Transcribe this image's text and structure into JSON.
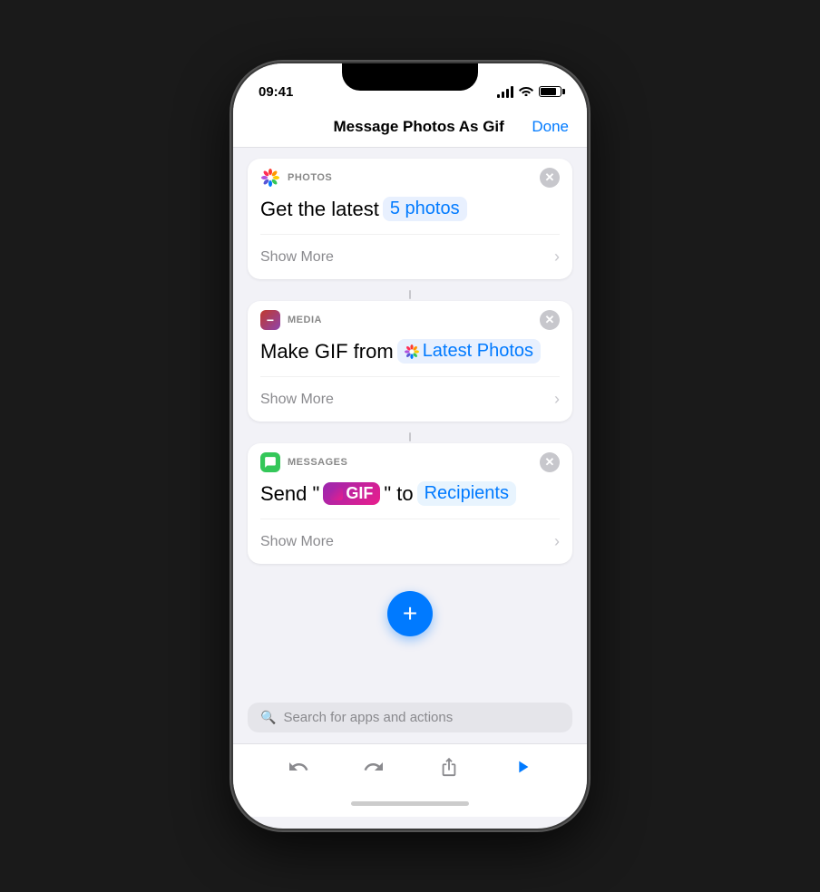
{
  "phone": {
    "time": "09:41",
    "title": "Message Photos As Gif",
    "done_button": "Done"
  },
  "cards": [
    {
      "id": "photos",
      "icon_label": "PHOTOS",
      "body_text": "Get the latest",
      "token_text": "5 photos",
      "show_more": "Show More"
    },
    {
      "id": "media",
      "icon_label": "MEDIA",
      "body_text": "Make GIF from",
      "token_text": "Latest Photos",
      "show_more": "Show More"
    },
    {
      "id": "messages",
      "icon_label": "MESSAGES",
      "body_prefix": "Send \"",
      "token_gif": "GIF",
      "body_suffix": "\" to",
      "token_recipients": "Recipients",
      "show_more": "Show More"
    }
  ],
  "add_button": {
    "label": "+"
  },
  "search": {
    "placeholder": "Search for apps and actions"
  },
  "toolbar": {
    "undo_label": "↩",
    "redo_label": "↪",
    "share_label": "⬆",
    "play_label": "▶"
  }
}
